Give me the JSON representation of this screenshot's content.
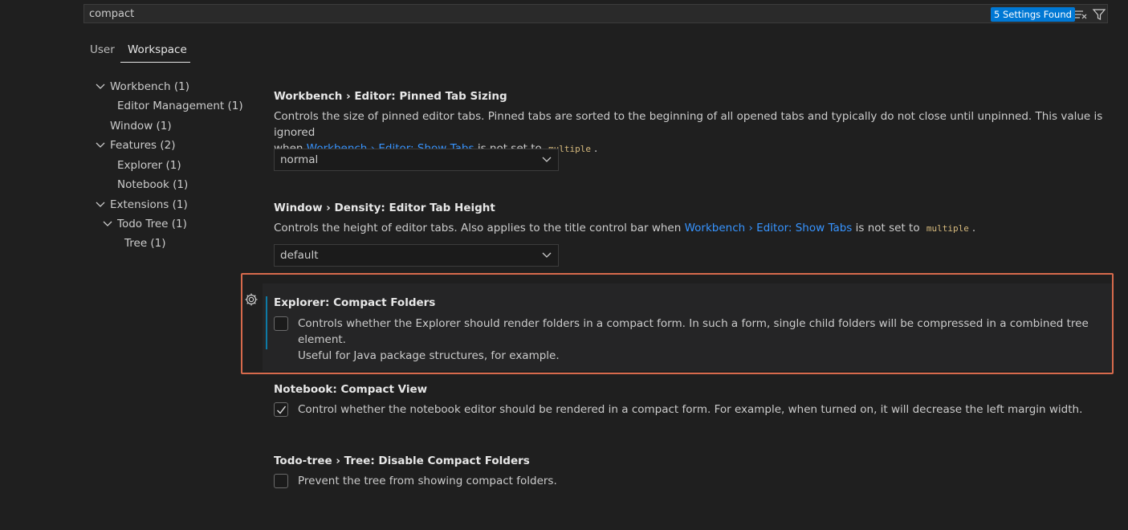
{
  "search": {
    "value": "compact",
    "results_badge": "5 Settings Found"
  },
  "scope_tabs": {
    "user": "User",
    "workspace": "Workspace",
    "active": "Workspace"
  },
  "toc": [
    {
      "label": "Workbench (1)",
      "expanded": true
    },
    {
      "label": "Editor Management (1)"
    },
    {
      "label": "Window (1)"
    },
    {
      "label": "Features (2)",
      "expanded": true
    },
    {
      "label": "Explorer (1)"
    },
    {
      "label": "Notebook (1)"
    },
    {
      "label": "Extensions (1)",
      "expanded": true
    },
    {
      "label": "Todo Tree (1)",
      "expanded": true
    },
    {
      "label": "Tree (1)"
    }
  ],
  "settings": {
    "pinned_tab_sizing": {
      "title": "Workbench › Editor: Pinned Tab Sizing",
      "desc_line1": "Controls the size of pinned editor tabs. Pinned tabs are sorted to the beginning of all opened tabs and typically do not close until unpinned. This value is ignored",
      "desc_when": "when",
      "desc_link": "Workbench › Editor: Show Tabs",
      "desc_mid": "is not set to",
      "desc_code": "multiple",
      "desc_end": ".",
      "value": "normal"
    },
    "editor_tab_height": {
      "title": "Window › Density: Editor Tab Height",
      "desc_pre": "Controls the height of editor tabs. Also applies to the title control bar when",
      "desc_link": "Workbench › Editor: Show Tabs",
      "desc_mid": "is not set to",
      "desc_code": "multiple",
      "desc_end": ".",
      "value": "default"
    },
    "compact_folders": {
      "title": "Explorer: Compact Folders",
      "desc_line1": "Controls whether the Explorer should render folders in a compact form. In such a form, single child folders will be compressed in a combined tree element.",
      "desc_line2": "Useful for Java package structures, for example.",
      "checked": false
    },
    "notebook_compact_view": {
      "title": "Notebook: Compact View",
      "desc": "Control whether the notebook editor should be rendered in a compact form. For example, when turned on, it will decrease the left margin width.",
      "checked": true
    },
    "todo_disable_compact": {
      "title": "Todo-tree › Tree: Disable Compact Folders",
      "desc": "Prevent the tree from showing compact folders.",
      "checked": false
    }
  },
  "colors": {
    "background": "#1f1f1f",
    "accent": "#0078d4",
    "link": "#3794ff",
    "highlight_outline": "#d76a4c",
    "modified_indicator": "#0e7aa6"
  },
  "icons": [
    "clear-filter-icon",
    "filter-icon",
    "chevron-down-icon",
    "gear-icon",
    "check-icon"
  ]
}
